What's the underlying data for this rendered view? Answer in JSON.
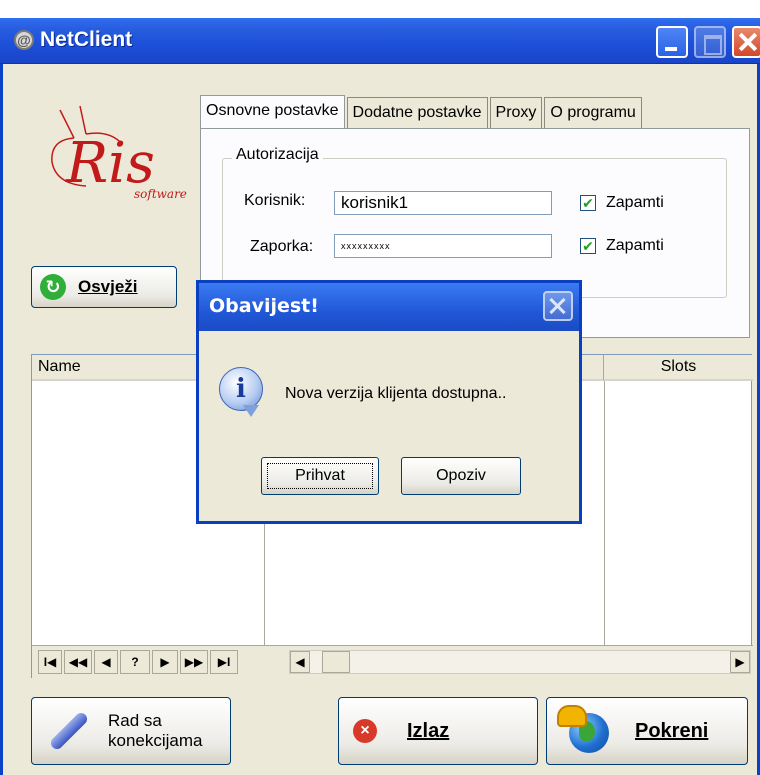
{
  "window": {
    "title": "NetClient"
  },
  "logo": {
    "brand": "Ris",
    "sub": "software"
  },
  "refresh_button": {
    "label": "Osvježi"
  },
  "tabs": [
    {
      "label": "Osnovne postavke",
      "active": true
    },
    {
      "label": "Dodatne postavke",
      "active": false
    },
    {
      "label": "Proxy",
      "active": false
    },
    {
      "label": "O programu",
      "active": false
    }
  ],
  "auth": {
    "legend": "Autorizacija",
    "user_label": "Korisnik:",
    "user_value": "korisnik1",
    "pass_label": "Zaporka:",
    "pass_value": "xxxxxxxxx",
    "remember_label": "Zapamti",
    "remember_user": true,
    "remember_pass": true
  },
  "grid": {
    "columns": [
      "Name",
      "Slots"
    ],
    "nav": [
      "I◀",
      "◀◀",
      "◀",
      "?",
      "▶",
      "▶▶",
      "▶I"
    ],
    "scroll_left": "◀",
    "scroll_right": "▶"
  },
  "buttons": {
    "connections_line1": "Rad sa",
    "connections_line2": "konekcijama",
    "exit": "Izlaz",
    "start": "Pokreni"
  },
  "dialog": {
    "title": "Obavijest!",
    "message": "Nova verzija klijenta dostupna..",
    "ok": "Prihvat",
    "cancel": "Opoziv"
  },
  "colors": {
    "titlebar": "#1d4fd8",
    "face": "#ece9d8"
  }
}
